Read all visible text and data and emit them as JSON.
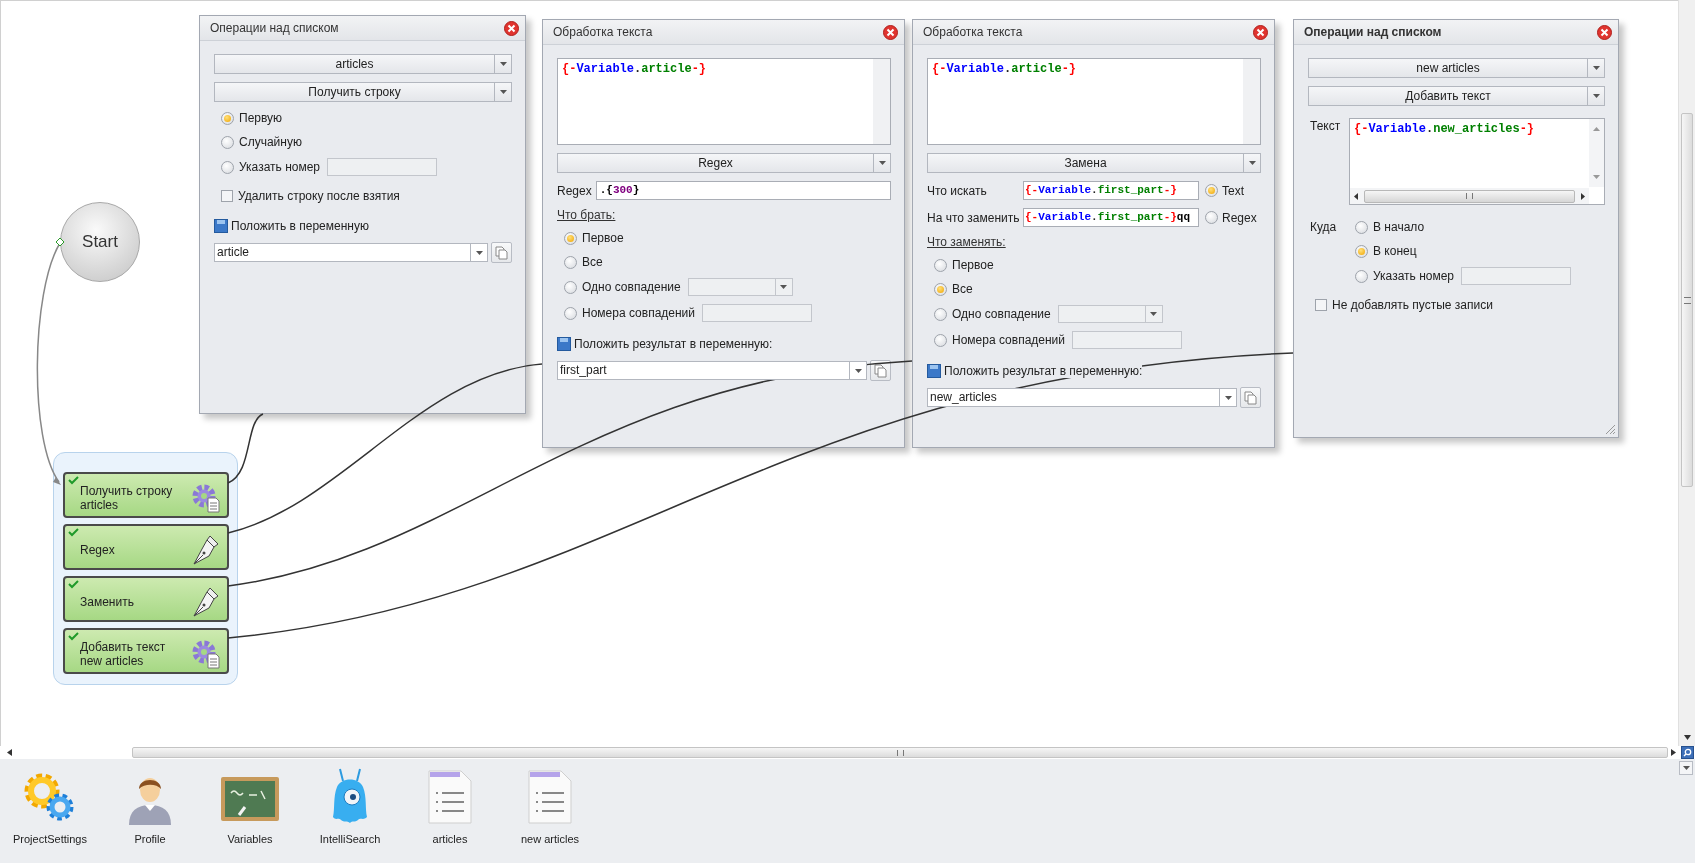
{
  "canvas": {
    "start": {
      "label": "Start"
    },
    "nodes": [
      {
        "label": "Получить строку articles",
        "kind": "gear"
      },
      {
        "label": "Regex",
        "kind": "pen"
      },
      {
        "label": "Заменить",
        "kind": "pen"
      },
      {
        "label": "Добавить текст new articles",
        "kind": "gear"
      }
    ],
    "windows": [
      {
        "title": "Операции над списком",
        "active": false,
        "controls": [
          {
            "kind": "dropdown",
            "value": "articles"
          },
          {
            "kind": "dropdown",
            "value": "Получить строку"
          },
          {
            "kind": "radio",
            "label": "Первую",
            "selected": true
          },
          {
            "kind": "radio",
            "label": "Случайную",
            "selected": false
          },
          {
            "kind": "radio_input",
            "label": "Указать номер",
            "selected": false
          },
          {
            "kind": "checkbox",
            "label": "Удалить строку после взятия",
            "checked": false
          },
          {
            "kind": "save_label",
            "label": "Положить в переменную"
          },
          {
            "kind": "variable",
            "value": "article"
          }
        ]
      },
      {
        "title": "Обработка текста",
        "active": false,
        "controls": [
          {
            "kind": "code",
            "tokens": [
              {
                "text": "{-",
                "color": "#ff0000"
              },
              {
                "text": "Variable",
                "color": "#0000ff"
              },
              {
                "text": "."
              },
              {
                "text": "article",
                "color": "#008000"
              },
              {
                "text": "-}",
                "color": "#ff0000"
              }
            ]
          },
          {
            "kind": "dropdown",
            "value": "Regex"
          },
          {
            "kind": "field",
            "label": "Regex",
            "tokens": [
              {
                "text": ".{",
                "color": "#000000"
              },
              {
                "text": "300",
                "color": "#800080"
              },
              {
                "text": "}",
                "color": "#000000"
              }
            ]
          },
          {
            "kind": "heading",
            "label": "Что брать:"
          },
          {
            "kind": "radio",
            "label": "Первое",
            "selected": true
          },
          {
            "kind": "radio",
            "label": "Все",
            "selected": false
          },
          {
            "kind": "radio_combo",
            "label": "Одно совпадение",
            "selected": false
          },
          {
            "kind": "radio_input",
            "label": "Номера совпадений",
            "selected": false
          },
          {
            "kind": "save_label",
            "label": "Положить результат в переменную:"
          },
          {
            "kind": "variable",
            "value": "first_part"
          }
        ]
      },
      {
        "title": "Обработка текста",
        "active": false,
        "controls": [
          {
            "kind": "code",
            "tokens": [
              {
                "text": "{-",
                "color": "#ff0000"
              },
              {
                "text": "Variable",
                "color": "#0000ff"
              },
              {
                "text": "."
              },
              {
                "text": "article",
                "color": "#008000"
              },
              {
                "text": "-}",
                "color": "#ff0000"
              }
            ]
          },
          {
            "kind": "dropdown",
            "value": "Замена"
          },
          {
            "kind": "field_option",
            "label": "Что искать",
            "tokens": [
              {
                "text": "{-",
                "color": "#ff0000"
              },
              {
                "text": "Variable",
                "color": "#0000ff"
              },
              {
                "text": "."
              },
              {
                "text": "first_part",
                "color": "#008000"
              },
              {
                "text": "-}",
                "color": "#ff0000"
              }
            ],
            "option": {
              "label": "Text",
              "selected": true
            }
          },
          {
            "kind": "field_option",
            "label": "На что заменить",
            "tokens": [
              {
                "text": "{-",
                "color": "#ff0000"
              },
              {
                "text": "Variable",
                "color": "#0000ff"
              },
              {
                "text": "."
              },
              {
                "text": "first_part",
                "color": "#008000"
              },
              {
                "text": "-}",
                "color": "#ff0000"
              },
              {
                "text": "qq",
                "color": "#000000"
              }
            ],
            "option": {
              "label": "Regex",
              "selected": false
            }
          },
          {
            "kind": "heading",
            "label": "Что заменять:"
          },
          {
            "kind": "radio",
            "label": "Первое",
            "selected": false
          },
          {
            "kind": "radio",
            "label": "Все",
            "selected": true
          },
          {
            "kind": "radio_combo",
            "label": "Одно совпадение",
            "selected": false
          },
          {
            "kind": "radio_input",
            "label": "Номера совпадений",
            "selected": false
          },
          {
            "kind": "save_label",
            "label": "Положить результат в переменную:"
          },
          {
            "kind": "variable",
            "value": "new_articles"
          }
        ]
      },
      {
        "title": "Операции над списком",
        "active": true,
        "controls": [
          {
            "kind": "dropdown",
            "value": "new articles"
          },
          {
            "kind": "dropdown",
            "value": "Добавить текст"
          },
          {
            "kind": "text_area",
            "label": "Текст",
            "tokens": [
              {
                "text": "{-",
                "color": "#ff0000"
              },
              {
                "text": "Variable",
                "color": "#0000ff"
              },
              {
                "text": "."
              },
              {
                "text": "new_articles",
                "color": "#008000"
              },
              {
                "text": "-}",
                "color": "#ff0000"
              }
            ]
          },
          {
            "kind": "radio_group",
            "label": "Куда",
            "options": [
              {
                "kind": "radio",
                "label": "В начало",
                "selected": false
              },
              {
                "kind": "radio",
                "label": "В конец",
                "selected": true
              },
              {
                "kind": "radio_input",
                "label": "Указать номер",
                "selected": false
              }
            ]
          },
          {
            "kind": "checkbox",
            "label": "Не добавлять пустые записи",
            "checked": false
          }
        ]
      }
    ]
  },
  "toolbar": {
    "items": [
      {
        "label": "ProjectSettings",
        "kind": "gears"
      },
      {
        "label": "Profile",
        "kind": "person"
      },
      {
        "label": "Variables",
        "kind": "board"
      },
      {
        "label": "IntelliSearch",
        "kind": "blob"
      },
      {
        "label": "articles",
        "kind": "list"
      },
      {
        "label": "new articles",
        "kind": "list"
      }
    ]
  }
}
